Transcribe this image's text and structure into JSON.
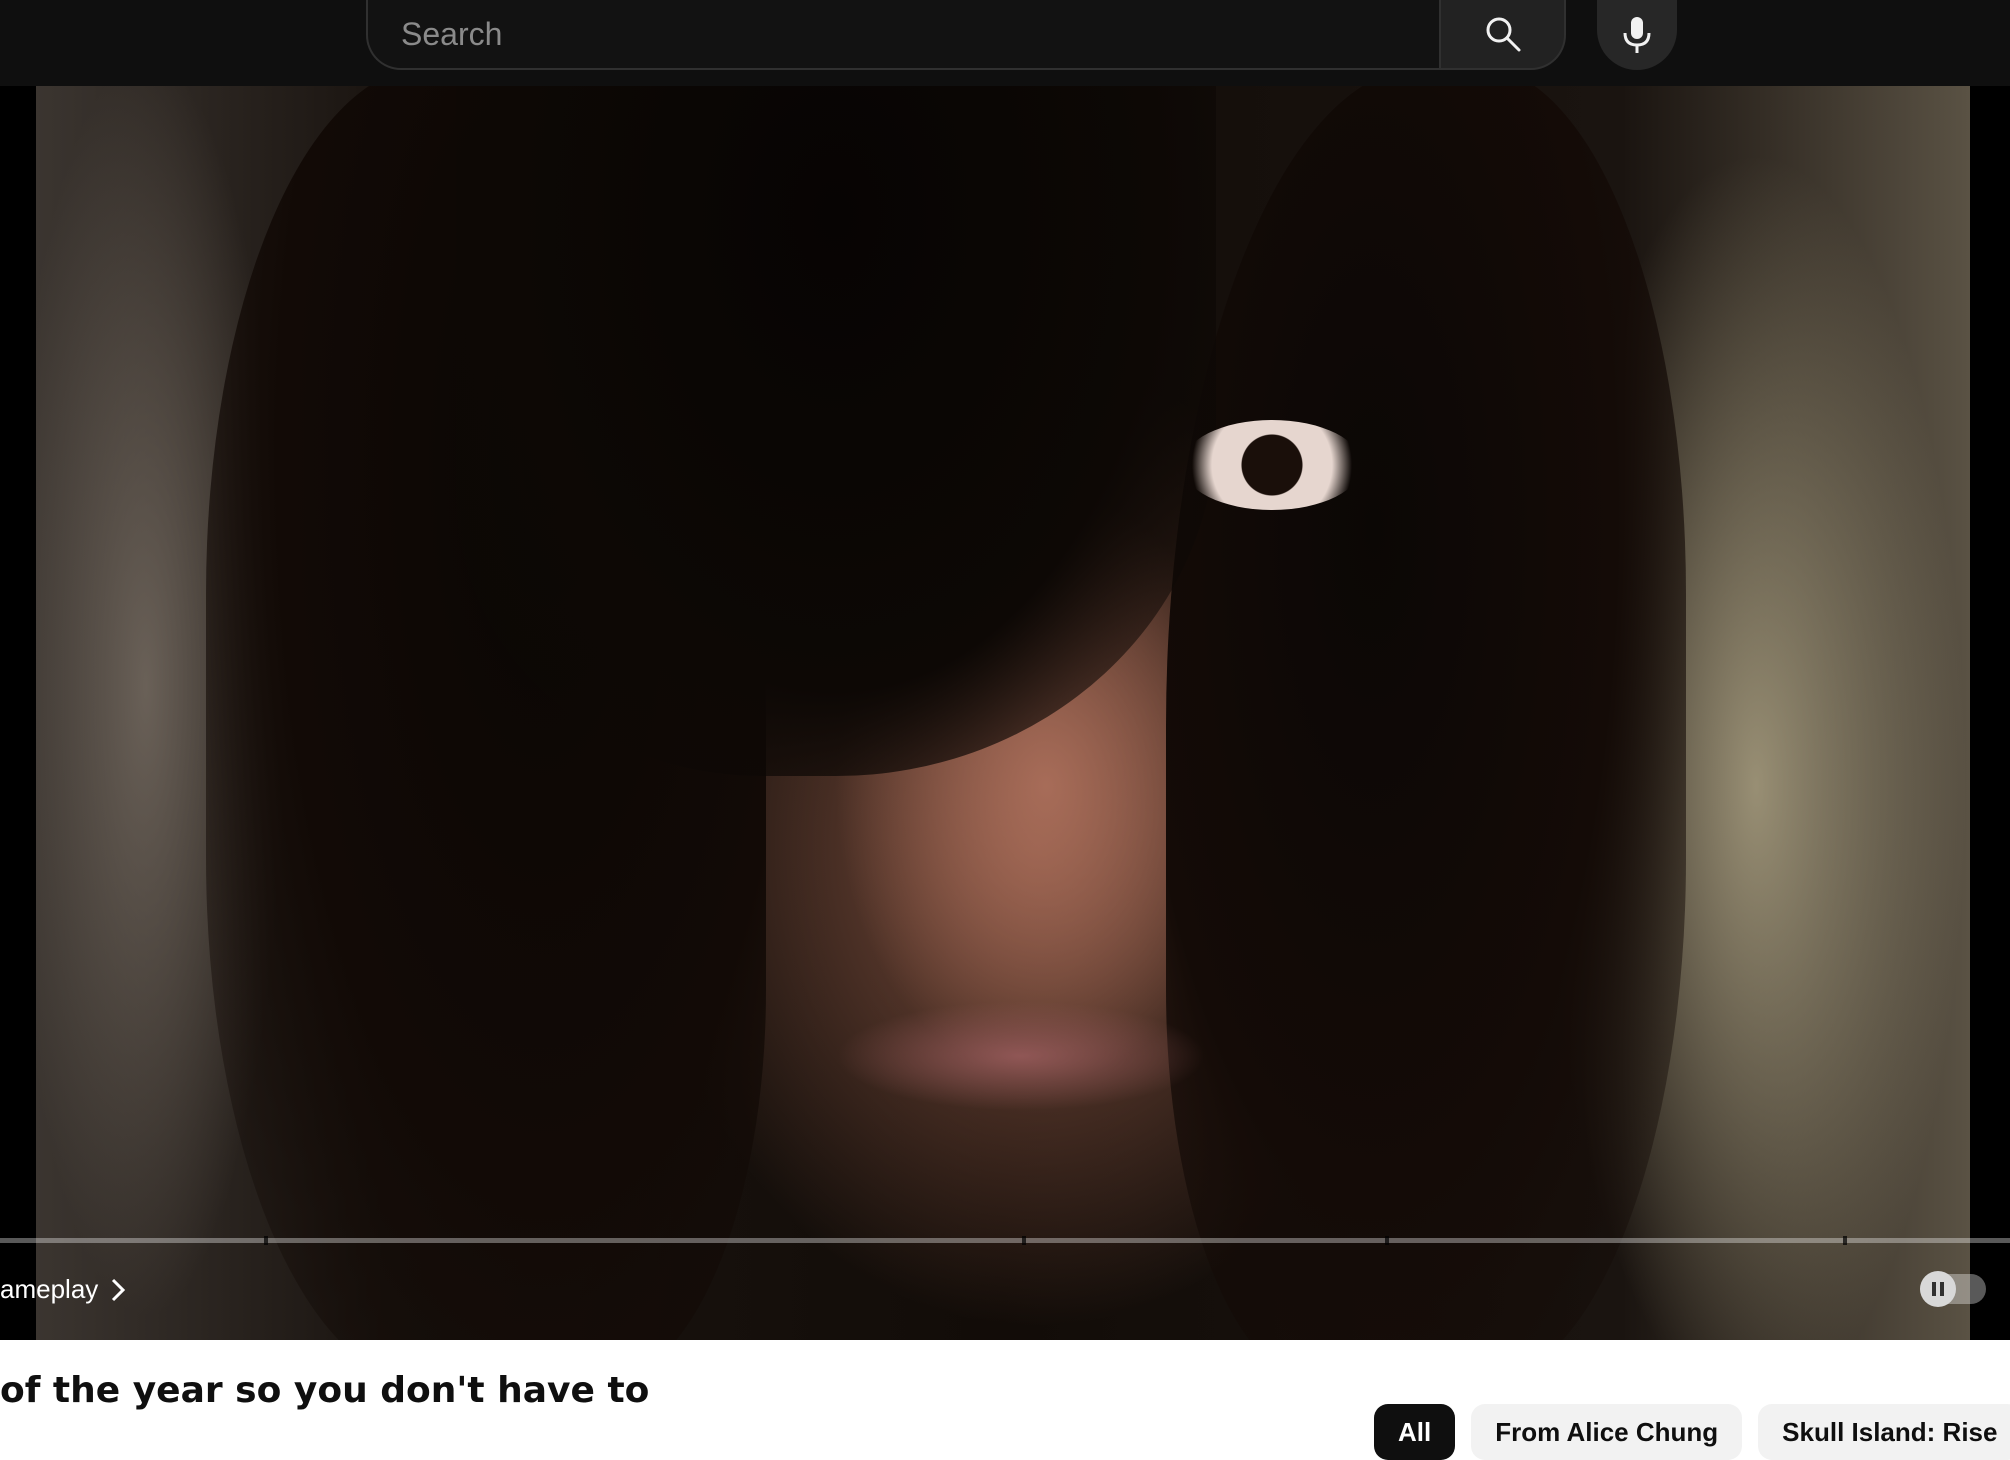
{
  "search": {
    "placeholder": "Search"
  },
  "icons": {
    "search": "search-icon",
    "mic": "microphone-icon",
    "chevron": "chevron-right-icon",
    "pause": "pause-icon"
  },
  "player": {
    "chapter_label": "ameplay",
    "autoplay_on": true
  },
  "video": {
    "title": "of the year so you don't have to"
  },
  "chips": [
    {
      "label": "All",
      "active": true
    },
    {
      "label": "From Alice Chung",
      "active": false
    },
    {
      "label": "Skull Island: Rise",
      "active": false
    }
  ],
  "colors": {
    "topbar": "#0f0f0f",
    "chip_active": "#0f0f0f",
    "chip_inactive": "#f2f2f2"
  }
}
